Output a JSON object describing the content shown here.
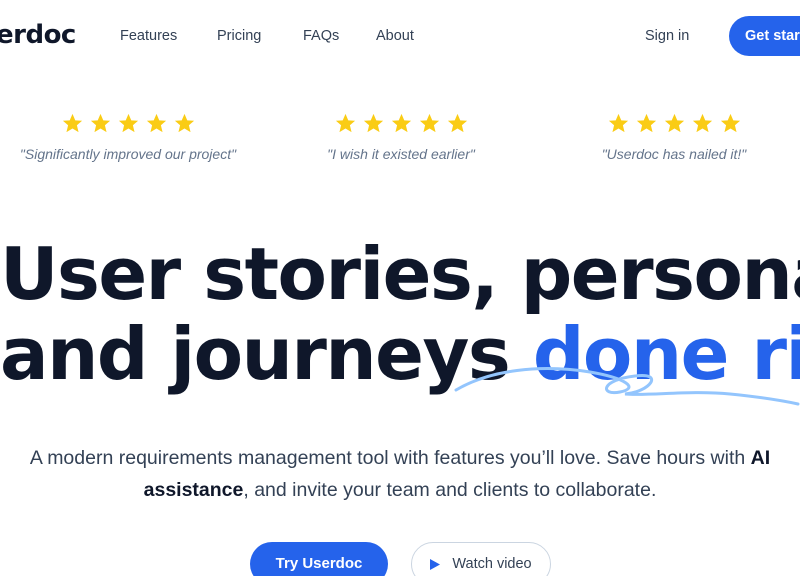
{
  "header": {
    "logo": "erdoc",
    "nav": [
      "Features",
      "Pricing",
      "FAQs",
      "About"
    ],
    "sign_in": "Sign in",
    "get_started": "Get star"
  },
  "reviews": [
    {
      "stars": 5,
      "quote": "\"Significantly improved our project\""
    },
    {
      "stars": 5,
      "quote": "\"I wish it existed earlier\""
    },
    {
      "stars": 5,
      "quote": "\"Userdoc has nailed it!\""
    }
  ],
  "hero": {
    "line1": "User stories, personas,",
    "line2_plain": "and journeys ",
    "line2_highlight": "done right",
    "sub_part1": "A modern requirements management tool with features you’ll love. Save hours with ",
    "sub_bold": "AI assistance",
    "sub_part2": ", and invite your team and clients to collaborate."
  },
  "cta": {
    "primary": "Try Userdoc",
    "video": "Watch video"
  },
  "colors": {
    "accent": "#2563eb",
    "star": "#facc15",
    "text": "#0f172a"
  }
}
